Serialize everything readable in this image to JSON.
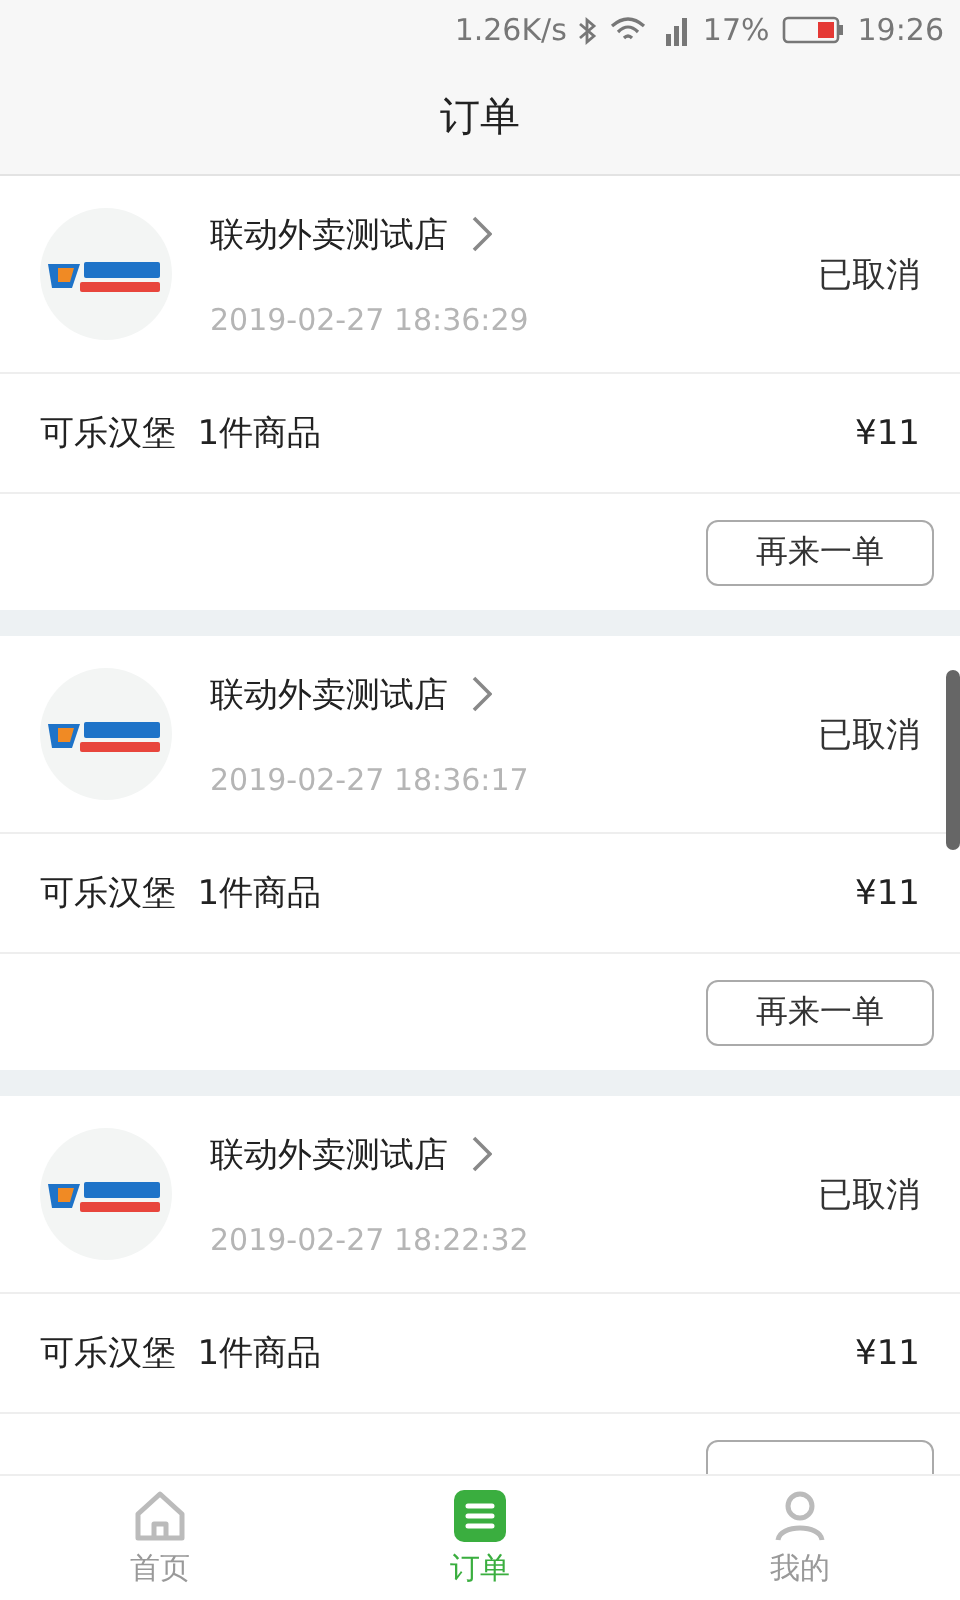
{
  "status_bar": {
    "speed": "1.26K/s",
    "battery": "17%",
    "time": "19:26"
  },
  "header": {
    "title": "订单"
  },
  "orders": [
    {
      "shop": "联动外卖测试店",
      "time": "2019-02-27 18:36:29",
      "status": "已取消",
      "items": "可乐汉堡  1件商品",
      "price": "¥11",
      "action": "再来一单"
    },
    {
      "shop": "联动外卖测试店",
      "time": "2019-02-27 18:36:17",
      "status": "已取消",
      "items": "可乐汉堡  1件商品",
      "price": "¥11",
      "action": "再来一单"
    },
    {
      "shop": "联动外卖测试店",
      "time": "2019-02-27 18:22:32",
      "status": "已取消",
      "items": "可乐汉堡  1件商品",
      "price": "¥11"
    }
  ],
  "tab_bar": [
    {
      "kind": "home",
      "label": "首页",
      "selected": false
    },
    {
      "kind": "orders",
      "label": "订单",
      "selected": true
    },
    {
      "kind": "profile",
      "label": "我的",
      "selected": false
    }
  ]
}
